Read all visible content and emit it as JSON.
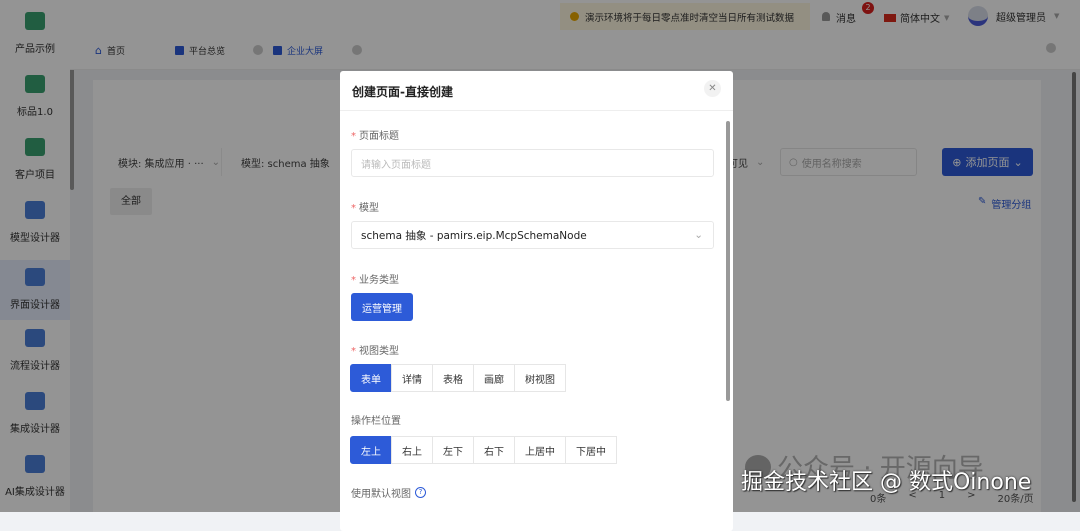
{
  "sidebar": {
    "items": [
      {
        "label": "产品示例",
        "icon": "code-icon",
        "color": "#3aa070"
      },
      {
        "label": "标品1.0",
        "icon": "bar-chart-icon",
        "color": "#3aa070"
      },
      {
        "label": "客户项目",
        "icon": "users-icon",
        "color": "#3aa070"
      },
      {
        "label": "模型设计器",
        "icon": "cube-icon",
        "color": "#4a7ed8"
      },
      {
        "label": "界面设计器",
        "icon": "layout-icon",
        "color": "#4a7ed8"
      },
      {
        "label": "流程设计器",
        "icon": "flow-icon",
        "color": "#4a7ed8"
      },
      {
        "label": "集成设计器",
        "icon": "layers-icon",
        "color": "#4a7ed8"
      },
      {
        "label": "AI集成设计器",
        "icon": "ai-icon",
        "color": "#4a7ed8"
      }
    ]
  },
  "topbar": {
    "notice": "演示环境将于每日零点准时清空当日所有测试数据",
    "messages": "消息",
    "badge": "2",
    "language": "简体中文",
    "user": "超级管理员"
  },
  "tabs": [
    {
      "label": "首页"
    },
    {
      "label": "平台总览"
    },
    {
      "label": "企业大屏"
    }
  ],
  "filters": {
    "module": "模块: 集成应用 · ···",
    "model": "模型: schema 抽象",
    "visible": "可见",
    "search_placeholder": "使用名称搜索",
    "add_page": "添加页面",
    "all": "全部",
    "manage_groups": "管理分组"
  },
  "pagination": {
    "total": "0条",
    "prev": "<",
    "page": "1",
    "next": ">",
    "page_size": "20条/页"
  },
  "watermarks": {
    "wechat": "公众号 · 开源向导",
    "juejin": "掘金技术社区 @ 数式Oinone"
  },
  "modal": {
    "title": "创建页面-直接创建",
    "page_title_label": "页面标题",
    "page_title_placeholder": "请输入页面标题",
    "model_label": "模型",
    "model_value": "schema 抽象 - pamirs.eip.McpSchemaNode",
    "biz_type_label": "业务类型",
    "biz_type_value": "运营管理",
    "view_type_label": "视图类型",
    "view_types": [
      "表单",
      "详情",
      "表格",
      "画廊",
      "树视图"
    ],
    "action_bar_label": "操作栏位置",
    "action_positions": [
      "左上",
      "右上",
      "左下",
      "右下",
      "上居中",
      "下居中"
    ],
    "default_view_label": "使用默认视图"
  },
  "colors": {
    "primary": "#2d5bd8"
  }
}
